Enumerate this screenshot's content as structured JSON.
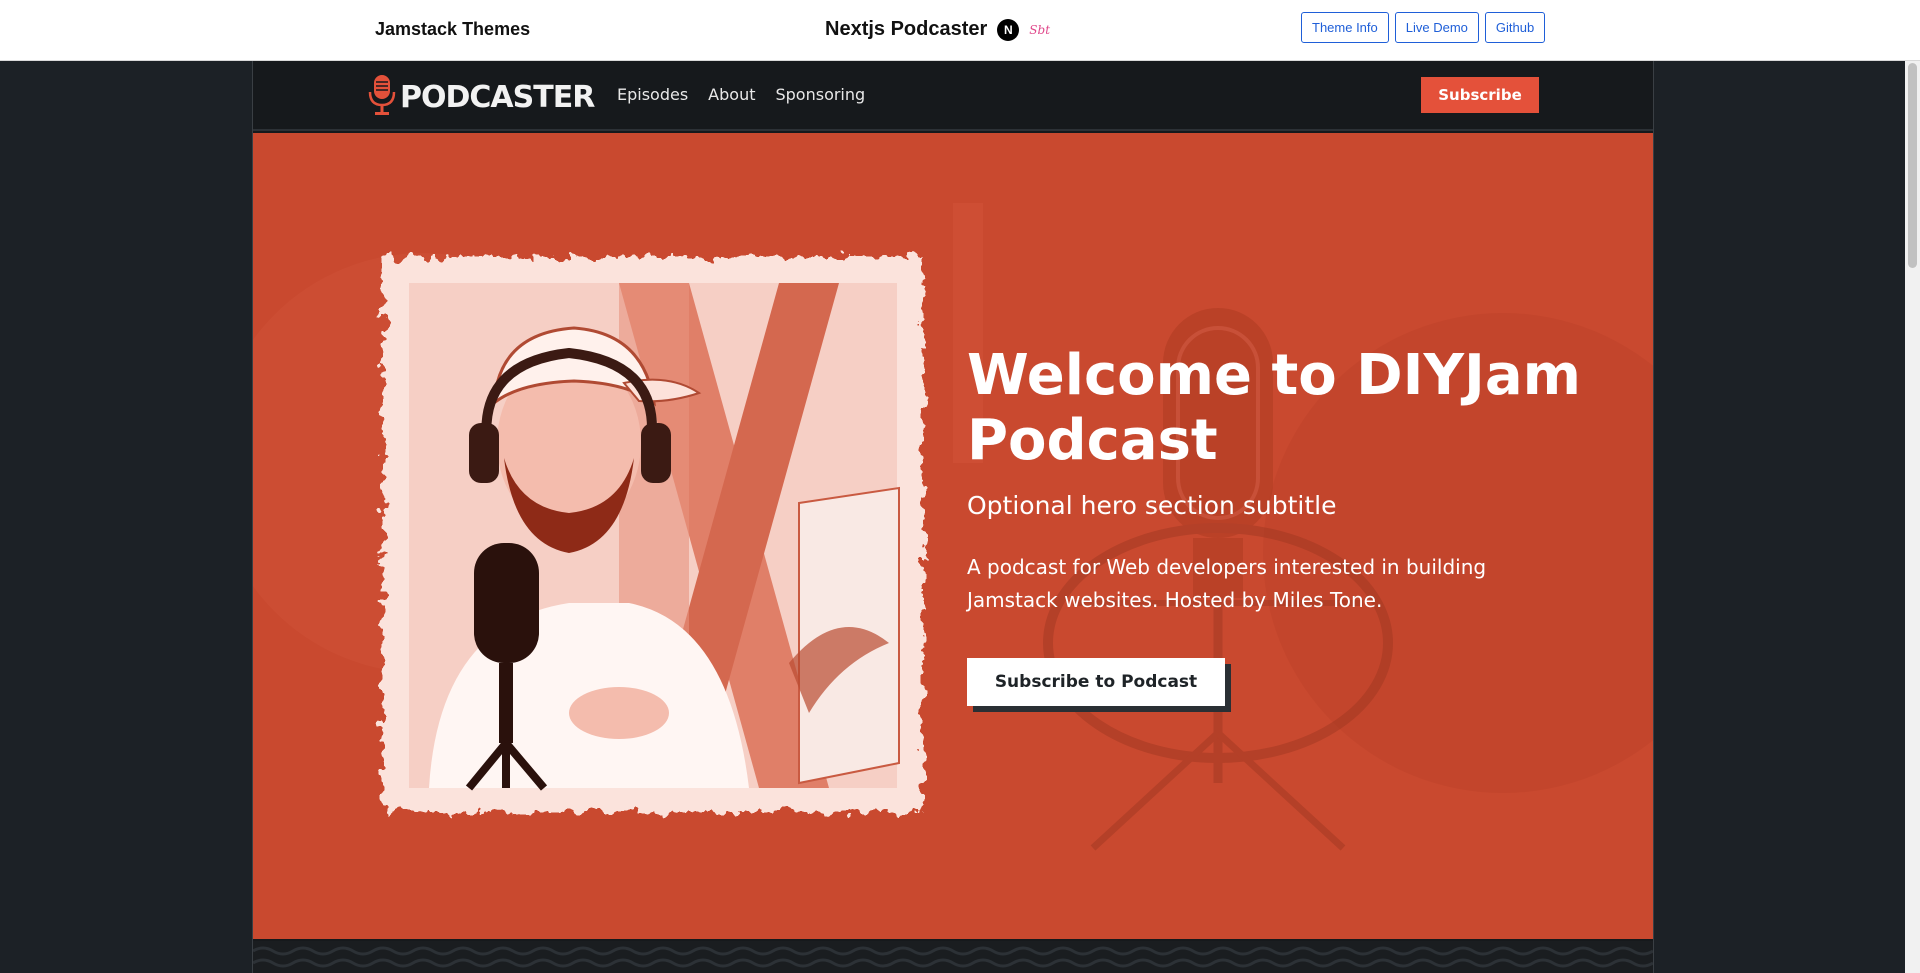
{
  "topbar": {
    "brand": "Jamstack Themes",
    "title": "Nextjs Podcaster",
    "next_logo_letter": "N",
    "stackbit_logo_text": "Sbt",
    "buttons": [
      {
        "label": "Theme Info"
      },
      {
        "label": "Live Demo"
      },
      {
        "label": "Github"
      }
    ]
  },
  "site": {
    "logo_text": "PODCASTER",
    "nav": [
      {
        "label": "Episodes"
      },
      {
        "label": "About"
      },
      {
        "label": "Sponsoring"
      }
    ],
    "subscribe_label": "Subscribe"
  },
  "hero": {
    "title": "Welcome to DIYJam Podcast",
    "subtitle": "Optional hero section subtitle",
    "description": "A podcast for Web developers interested in building Jamstack websites. Hosted by Miles Tone.",
    "cta_label": "Subscribe to Podcast",
    "icons": {
      "logo": "microphone-icon"
    }
  },
  "colors": {
    "accent": "#e4513a",
    "hero_bg": "#c9492f",
    "dark": "#16191c",
    "link": "#1f5fd8"
  }
}
